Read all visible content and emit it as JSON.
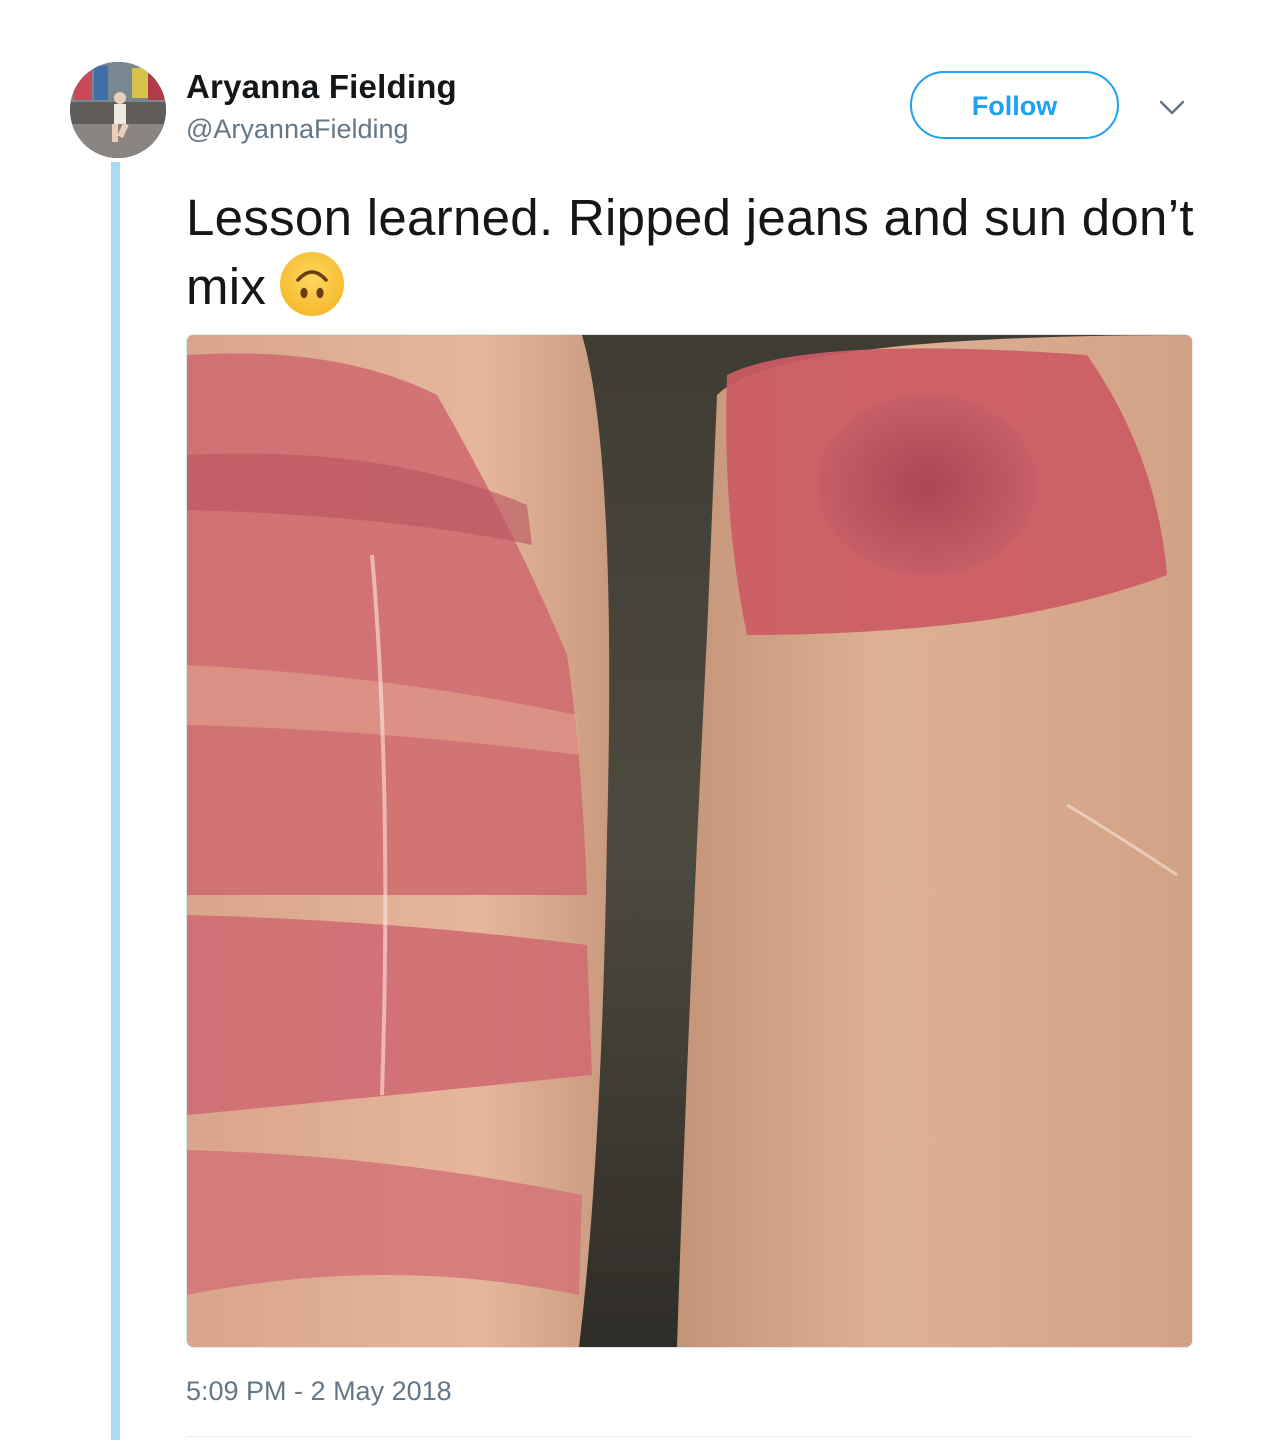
{
  "tweet": {
    "author": {
      "display_name": "Aryanna Fielding",
      "handle": "@AryannaFielding",
      "avatar_icon": "profile-photo"
    },
    "follow_label": "Follow",
    "menu_icon": "chevron-down-icon",
    "text": "Lesson learned. Ripped jeans and sun don’t mix",
    "emoji": "upside-down-face",
    "media_description_icon": "photo",
    "timestamp": "5:09 PM - 2 May 2018"
  },
  "colors": {
    "accent": "#1da1f2",
    "thread_line": "#a8dcf6",
    "secondary_text": "#657786",
    "primary_text": "#14171a"
  }
}
